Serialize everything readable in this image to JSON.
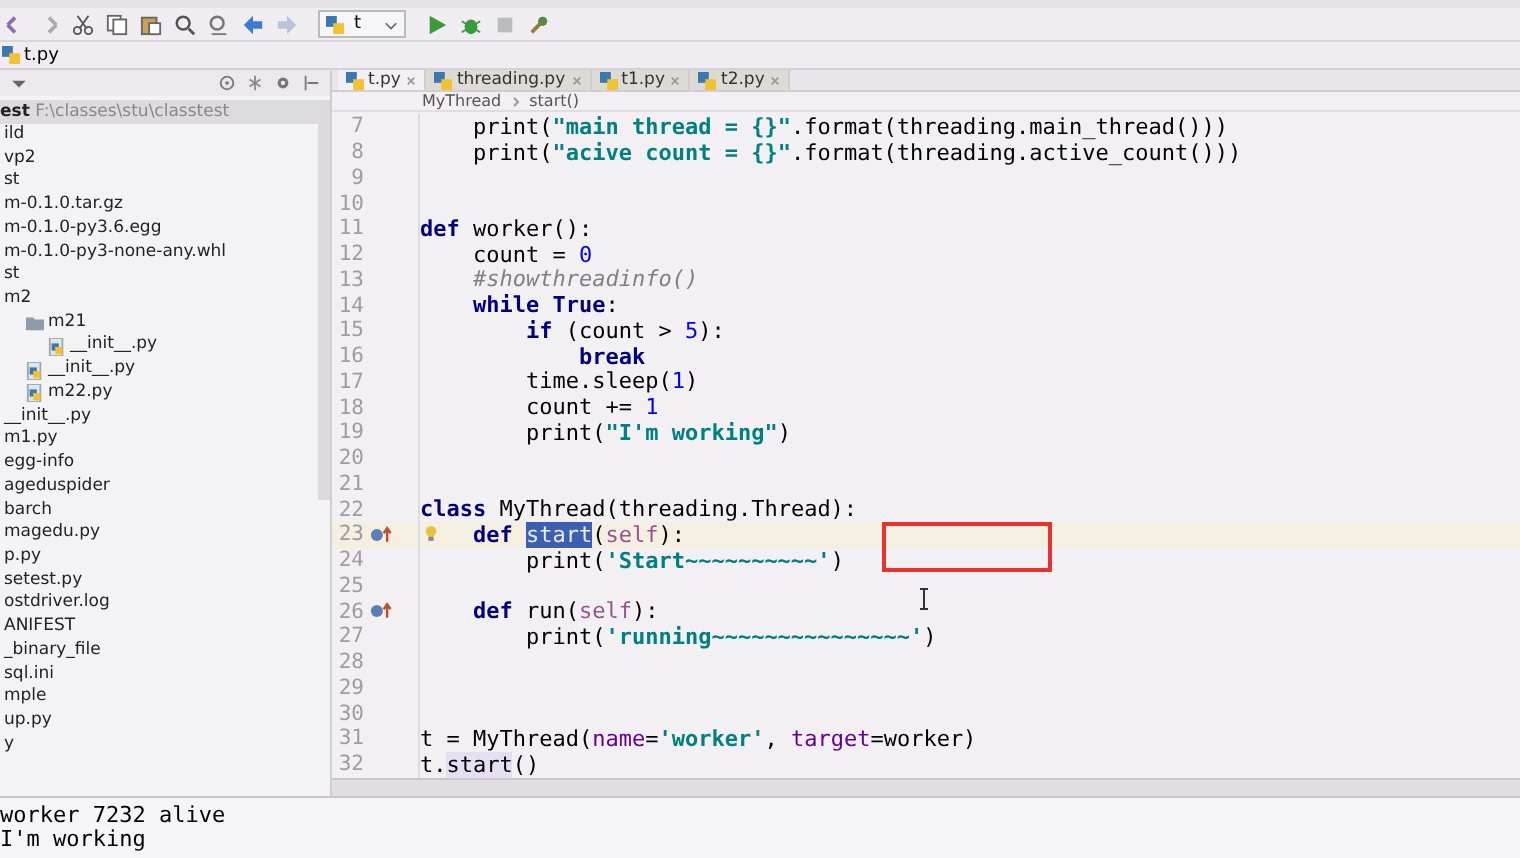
{
  "toolbar": {
    "run_config": "t"
  },
  "nav_bar": {
    "file": "t.py"
  },
  "project": {
    "root": {
      "name": "est",
      "path": "F:\\classes\\stu\\classtest",
      "selected": true
    },
    "items": [
      {
        "name": "ild"
      },
      {
        "name": "vp2"
      },
      {
        "name": "st"
      },
      {
        "name": "m-0.1.0.tar.gz"
      },
      {
        "name": "m-0.1.0-py3.6.egg"
      },
      {
        "name": "m-0.1.0-py3-none-any.whl"
      },
      {
        "name": "st"
      },
      {
        "name": "m2",
        "children": [
          {
            "name": "m21",
            "kind": "folder",
            "children": [
              {
                "name": "__init__.py",
                "kind": "python"
              }
            ]
          },
          {
            "name": "__init__.py",
            "kind": "python"
          },
          {
            "name": "m22.py",
            "kind": "python"
          }
        ]
      },
      {
        "name": "__init__.py"
      },
      {
        "name": "m1.py"
      },
      {
        "name": "egg-info"
      },
      {
        "name": "ageduspider"
      },
      {
        "name": "barch"
      },
      {
        "name": "magedu.py"
      },
      {
        "name": "p.py"
      },
      {
        "name": "setest.py"
      },
      {
        "name": "ostdriver.log"
      },
      {
        "name": "ANIFEST"
      },
      {
        "name": "_binary_file"
      },
      {
        "name": "sql.ini"
      },
      {
        "name": "mple"
      },
      {
        "name": "up.py"
      },
      {
        "name": "y"
      }
    ]
  },
  "tabs": [
    {
      "label": "t.py",
      "selected": true
    },
    {
      "label": "threading.py",
      "selected": false
    },
    {
      "label": "t1.py",
      "selected": false
    },
    {
      "label": "t2.py",
      "selected": false
    }
  ],
  "breadcrumb": [
    "MyThread",
    "start()"
  ],
  "code": [
    {
      "number": "7",
      "current": false,
      "overridden": false,
      "bulb": false,
      "segments": [
        {
          "kind": "plain",
          "text": "    print("
        },
        {
          "kind": "string",
          "text": "\"main thread = {}\""
        },
        {
          "kind": "plain",
          "text": ".format(threading.main_thread()))"
        }
      ]
    },
    {
      "number": "8",
      "current": false,
      "overridden": false,
      "bulb": false,
      "segments": [
        {
          "kind": "plain",
          "text": "    print("
        },
        {
          "kind": "string",
          "text": "\"acive count = {}\""
        },
        {
          "kind": "plain",
          "text": ".format(threading.active_count()))"
        }
      ]
    },
    {
      "number": "9",
      "current": false,
      "overridden": false,
      "bulb": false
    },
    {
      "number": "10",
      "current": false,
      "overridden": false,
      "bulb": false
    },
    {
      "number": "11",
      "current": false,
      "overridden": false,
      "bulb": false,
      "segments": [
        {
          "kind": "keyword",
          "text": "def"
        },
        {
          "kind": "plain",
          "text": " worker():"
        }
      ]
    },
    {
      "number": "12",
      "current": false,
      "overridden": false,
      "bulb": false,
      "segments": [
        {
          "kind": "plain",
          "text": "    count = "
        },
        {
          "kind": "number",
          "text": "0"
        }
      ]
    },
    {
      "number": "13",
      "current": false,
      "overridden": false,
      "bulb": false,
      "segments": [
        {
          "kind": "comment",
          "text": "    #showthreadinfo()"
        }
      ]
    },
    {
      "number": "14",
      "current": false,
      "overridden": false,
      "bulb": false,
      "segments": [
        {
          "kind": "keyword",
          "text": "    while True"
        },
        {
          "kind": "plain",
          "text": ":"
        }
      ]
    },
    {
      "number": "15",
      "current": false,
      "overridden": false,
      "bulb": false,
      "segments": [
        {
          "kind": "keyword",
          "text": "        if"
        },
        {
          "kind": "plain",
          "text": " (count > "
        },
        {
          "kind": "number",
          "text": "5"
        },
        {
          "kind": "plain",
          "text": "):"
        }
      ]
    },
    {
      "number": "16",
      "current": false,
      "overridden": false,
      "bulb": false,
      "segments": [
        {
          "kind": "keyword",
          "text": "            break"
        }
      ]
    },
    {
      "number": "17",
      "current": false,
      "overridden": false,
      "bulb": false,
      "segments": [
        {
          "kind": "plain",
          "text": "        time.sleep("
        },
        {
          "kind": "number",
          "text": "1"
        },
        {
          "kind": "plain",
          "text": ")"
        }
      ]
    },
    {
      "number": "18",
      "current": false,
      "overridden": false,
      "bulb": false,
      "segments": [
        {
          "kind": "plain",
          "text": "        count += "
        },
        {
          "kind": "number",
          "text": "1"
        }
      ]
    },
    {
      "number": "19",
      "current": false,
      "overridden": false,
      "bulb": false,
      "segments": [
        {
          "kind": "plain",
          "text": "        print("
        },
        {
          "kind": "string",
          "text": "\"I'm working\""
        },
        {
          "kind": "plain",
          "text": ")"
        }
      ]
    },
    {
      "number": "20",
      "current": false,
      "overridden": false,
      "bulb": false
    },
    {
      "number": "21",
      "current": false,
      "overridden": false,
      "bulb": false
    },
    {
      "number": "22",
      "current": false,
      "overridden": false,
      "bulb": false,
      "segments": [
        {
          "kind": "keyword",
          "text": "class"
        },
        {
          "kind": "plain",
          "text": " MyThread(threading.Thread):"
        }
      ]
    },
    {
      "number": "23",
      "current": true,
      "overridden": true,
      "bulb": true,
      "segments": [
        {
          "kind": "keyword",
          "text": "    def "
        },
        {
          "kind": "selection",
          "text": "start"
        },
        {
          "kind": "plain",
          "text": "("
        },
        {
          "kind": "self",
          "text": "self"
        },
        {
          "kind": "plain",
          "text": "):"
        }
      ]
    },
    {
      "number": "24",
      "current": false,
      "overridden": false,
      "bulb": false,
      "segments": [
        {
          "kind": "plain",
          "text": "        print("
        },
        {
          "kind": "string",
          "text": "'Start~~~~~~~~~~'"
        },
        {
          "kind": "plain",
          "text": ")"
        }
      ]
    },
    {
      "number": "25",
      "current": false,
      "overridden": false,
      "bulb": false
    },
    {
      "number": "26",
      "current": false,
      "overridden": true,
      "bulb": false,
      "segments": [
        {
          "kind": "keyword",
          "text": "    def"
        },
        {
          "kind": "plain",
          "text": " run("
        },
        {
          "kind": "self",
          "text": "self"
        },
        {
          "kind": "plain",
          "text": "):"
        }
      ]
    },
    {
      "number": "27",
      "current": false,
      "overridden": false,
      "bulb": false,
      "segments": [
        {
          "kind": "plain",
          "text": "        print("
        },
        {
          "kind": "string",
          "text": "'running~~~~~~~~~~~~~~~'"
        },
        {
          "kind": "plain",
          "text": ")"
        }
      ]
    },
    {
      "number": "28",
      "current": false,
      "overridden": false,
      "bulb": false
    },
    {
      "number": "29",
      "current": false,
      "overridden": false,
      "bulb": false
    },
    {
      "number": "30",
      "current": false,
      "overridden": false,
      "bulb": false
    },
    {
      "number": "31",
      "current": false,
      "overridden": false,
      "bulb": false,
      "segments": [
        {
          "kind": "plain",
          "text": "t = MyThread("
        },
        {
          "kind": "param",
          "text": "name"
        },
        {
          "kind": "plain",
          "text": "="
        },
        {
          "kind": "string",
          "text": "'worker'"
        },
        {
          "kind": "plain",
          "text": ", "
        },
        {
          "kind": "param",
          "text": "target"
        },
        {
          "kind": "plain",
          "text": "=worker)"
        }
      ]
    },
    {
      "number": "32",
      "current": false,
      "overridden": false,
      "bulb": false,
      "segments": [
        {
          "kind": "plain",
          "text": "t."
        },
        {
          "kind": "usage",
          "text": "start"
        },
        {
          "kind": "plain",
          "text": "()"
        }
      ]
    }
  ],
  "console": [
    "worker 7232 alive",
    "I'm working"
  ]
}
